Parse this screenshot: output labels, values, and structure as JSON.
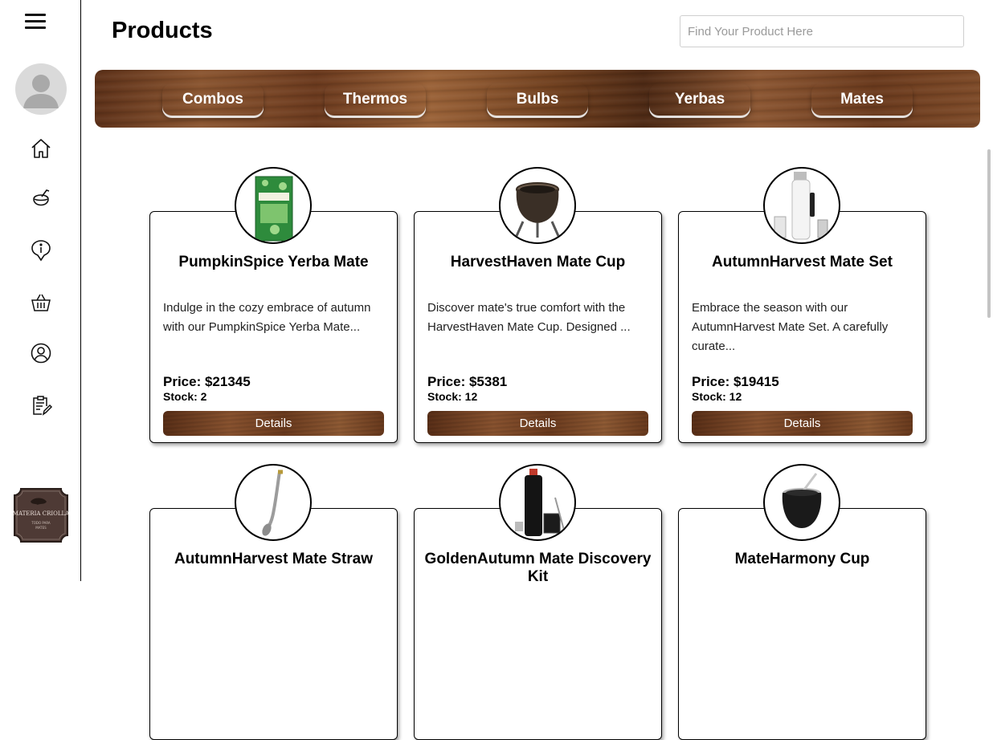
{
  "page": {
    "title": "Products",
    "search_placeholder": "Find Your Product Here"
  },
  "sidebar": {
    "menu_icon": "hamburger-menu-icon",
    "avatar_icon": "user-avatar-icon",
    "items": [
      {
        "icon": "home-icon"
      },
      {
        "icon": "mate-gourd-icon"
      },
      {
        "icon": "info-icon"
      },
      {
        "icon": "basket-icon"
      },
      {
        "icon": "user-circle-icon"
      },
      {
        "icon": "clipboard-edit-icon"
      }
    ],
    "logo": {
      "line1": "MATERIA CRIOLLA",
      "line2": "TODO PARA",
      "line3": "MATES"
    }
  },
  "categories": [
    "Combos",
    "Thermos",
    "Bulbs",
    "Yerbas",
    "Mates"
  ],
  "products": [
    {
      "name": "PumpkinSpice Yerba Mate",
      "description": "Indulge in the cozy embrace of autumn with our PumpkinSpice Yerba Mate...",
      "price": "Price: $21345",
      "stock": "Stock: 2",
      "button": "Details",
      "image": "yerba-package"
    },
    {
      "name": "HarvestHaven Mate Cup",
      "description": "Discover mate's true comfort with the HarvestHaven Mate Cup. Designed ...",
      "price": "Price: $5381",
      "stock": "Stock: 12",
      "button": "Details",
      "image": "mate-cup"
    },
    {
      "name": "AutumnHarvest Mate Set",
      "description": "Embrace the season with our AutumnHarvest Mate Set. A carefully curate...",
      "price": "Price: $19415",
      "stock": "Stock: 12",
      "button": "Details",
      "image": "thermos-set"
    },
    {
      "name": "AutumnHarvest Mate Straw",
      "image": "bombilla-straw"
    },
    {
      "name": "GoldenAutumn Mate Discovery Kit",
      "image": "thermos-kit"
    },
    {
      "name": "MateHarmony Cup",
      "image": "black-mate-cup"
    }
  ]
}
